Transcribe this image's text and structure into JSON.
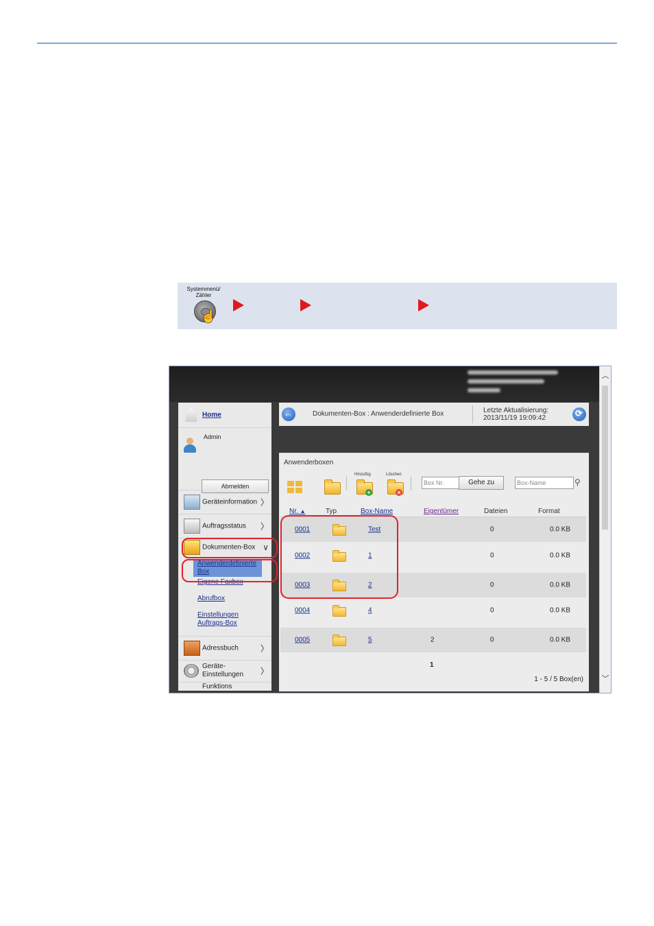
{
  "navbar": {
    "button_caption": "Systemmenü/ Zähler",
    "button_icon": "hand-press-icon",
    "arrow_color": "#e0191f"
  },
  "sidebar": {
    "home": "Home",
    "user": "Admin",
    "logout": "Abmelden",
    "items": [
      {
        "label": "Geräteinformation",
        "icon": "device-info-icon"
      },
      {
        "label": "Auftragsstatus",
        "icon": "job-status-icon"
      },
      {
        "label": "Dokumenten-Box",
        "icon": "document-box-icon"
      },
      {
        "label": "Adressbuch",
        "icon": "address-book-icon"
      },
      {
        "label": "Geräte- Einstellungen",
        "icon": "device-settings-icon"
      },
      {
        "label": "Funktions",
        "icon": "function-icon"
      }
    ],
    "subitems": [
      "Anwenderdefinierte Box",
      "Eigene Faxbox",
      "Abrufbox",
      "Einstellungen Auftrags-Box"
    ]
  },
  "breadcrumb": {
    "path": "Dokumenten-Box : Anwenderdefinierte Box",
    "updated_label": "Letzte Aktualisierung:",
    "updated_value": "2013/11/19 19:09:42"
  },
  "panel": {
    "title": "Anwenderboxen",
    "add_label": "Hinzufüg",
    "delete_label": "Löschen",
    "boxnr_placeholder": "Box Nr.",
    "goto_label": "Gehe zu",
    "boxname_placeholder": "Box-Name"
  },
  "table": {
    "headers": [
      "Nr.",
      "Typ",
      "Box-Name",
      "Eigentümer",
      "Dateien",
      "Format"
    ],
    "rows": [
      {
        "nr": "0001",
        "name": "Test",
        "owner": "",
        "files": "0",
        "format": "0.0 KB"
      },
      {
        "nr": "0002",
        "name": "1",
        "owner": "",
        "files": "0",
        "format": "0.0 KB"
      },
      {
        "nr": "0003",
        "name": "2",
        "owner": "",
        "files": "0",
        "format": "0.0 KB"
      },
      {
        "nr": "0004",
        "name": "4",
        "owner": "",
        "files": "0",
        "format": "0.0 KB"
      },
      {
        "nr": "0005",
        "name": "5",
        "owner": "2",
        "files": "0",
        "format": "0.0 KB"
      }
    ],
    "page": "1",
    "count": "1 - 5 / 5 Box(en)"
  },
  "colors": {
    "highlight": "#e1202a",
    "selected": "#6a93d8",
    "link": "#1a2e8a"
  }
}
